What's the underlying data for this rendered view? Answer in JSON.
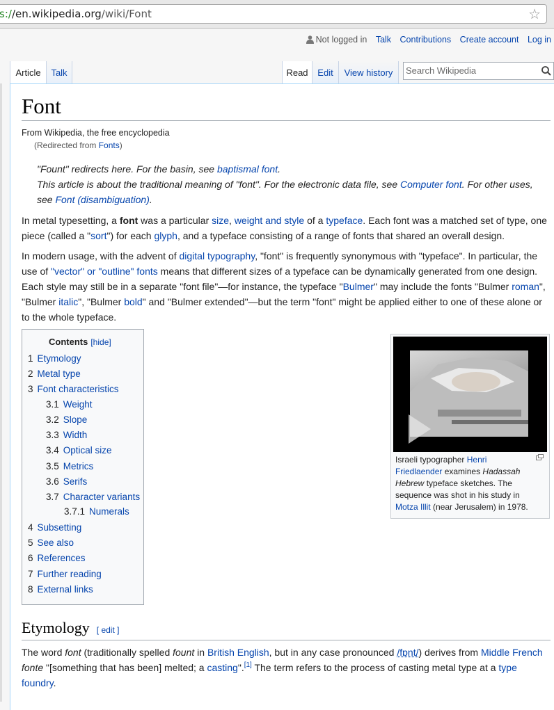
{
  "browser": {
    "url_scheme": "s:/",
    "url_host": "/en.wikipedia.org",
    "url_path": "/wiki/Font"
  },
  "personal": {
    "not_logged_in": "Not logged in",
    "talk": "Talk",
    "contributions": "Contributions",
    "create_account": "Create account",
    "log_in": "Log in"
  },
  "tabs": {
    "article": "Article",
    "talk": "Talk",
    "read": "Read",
    "edit": "Edit",
    "view_history": "View history"
  },
  "search": {
    "placeholder": "Search Wikipedia"
  },
  "page": {
    "title": "Font",
    "tagline": "From Wikipedia, the free encyclopedia",
    "redirect_prefix": "(Redirected from ",
    "redirect_link": "Fonts",
    "redirect_suffix": ")"
  },
  "hatnotes": {
    "h1_a": "\"Fount\" redirects here. For the basin, see ",
    "h1_link": "baptismal font",
    "h1_b": ".",
    "h2_a": "This article is about the traditional meaning of \"font\". For the electronic data file, see ",
    "h2_link": "Computer font",
    "h2_b": ". For other uses,",
    "h3_a": "see ",
    "h3_link": "Font (disambiguation)",
    "h3_b": "."
  },
  "p1": {
    "a": "In metal typesetting, a ",
    "bold": "font",
    "b": " was a particular ",
    "l1": "size",
    "c": ", ",
    "l2": "weight and style",
    "d": " of a ",
    "l3": "typeface",
    "e": ". Each font was a matched set of type, one",
    "f": "piece (called a \"",
    "l4": "sort",
    "g": "\") for each ",
    "l5": "glyph",
    "h": ", and a typeface consisting of a range of fonts that shared an overall design."
  },
  "p2": {
    "a": "In modern usage, with the advent of ",
    "l1": "digital typography",
    "b": ", \"font\" is frequently synonymous with \"typeface\". In particular, the",
    "c": "use of ",
    "l2": "\"vector\" or \"outline\" fonts",
    "d": " means that different sizes of a typeface can be dynamically generated from one design.",
    "e": "Each style may still be in a separate \"font file\"—for instance, the typeface \"",
    "l3": "Bulmer",
    "f": "\" may include the fonts \"Bulmer ",
    "l4": "roman",
    "g": "\",",
    "h": "\"Bulmer ",
    "l5": "italic",
    "i": "\", \"Bulmer ",
    "l6": "bold",
    "j": "\" and \"Bulmer extended\"—but the term \"font\" might be applied either to one of these alone or",
    "k": "to the whole typeface."
  },
  "toc": {
    "title": "Contents",
    "hide": "[hide]",
    "items": [
      {
        "num": "1",
        "label": "Etymology"
      },
      {
        "num": "2",
        "label": "Metal type"
      },
      {
        "num": "3",
        "label": "Font characteristics"
      },
      {
        "num": "3.1",
        "label": "Weight"
      },
      {
        "num": "3.2",
        "label": "Slope"
      },
      {
        "num": "3.3",
        "label": "Width"
      },
      {
        "num": "3.4",
        "label": "Optical size"
      },
      {
        "num": "3.5",
        "label": "Metrics"
      },
      {
        "num": "3.6",
        "label": "Serifs"
      },
      {
        "num": "3.7",
        "label": "Character variants"
      },
      {
        "num": "3.7.1",
        "label": "Numerals"
      },
      {
        "num": "4",
        "label": "Subsetting"
      },
      {
        "num": "5",
        "label": "See also"
      },
      {
        "num": "6",
        "label": "References"
      },
      {
        "num": "7",
        "label": "Further reading"
      },
      {
        "num": "8",
        "label": "External links"
      }
    ]
  },
  "thumb": {
    "a": "Israeli typographer ",
    "l1": "Henri",
    "l1b": "Friedlaender",
    "b": " examines ",
    "i1": "Hadassah",
    "i2": "Hebrew",
    "c": " typeface sketches. The",
    "d": "sequence was shot in his study in",
    "l2": "Motza Illit",
    "e": " (near Jerusalem) in 1978."
  },
  "etymology": {
    "heading": "Etymology",
    "edit": "[ edit ]",
    "a": "The word ",
    "i1": "font",
    "b": " (traditionally spelled ",
    "i2": "fount",
    "c": " in ",
    "l1": "British English",
    "d": ", but in any case pronounced ",
    "l2": "/fɒnt/",
    "e": ") derives from ",
    "l3": "Middle French",
    "i3": "fonte",
    "f": " \"[something that has been] melted; a ",
    "l4": "casting",
    "g": "\".",
    "ref": "[1]",
    "h": " The term refers to the process of casting metal type at a ",
    "l5": "type",
    "l5b": "foundry",
    "i": "."
  }
}
